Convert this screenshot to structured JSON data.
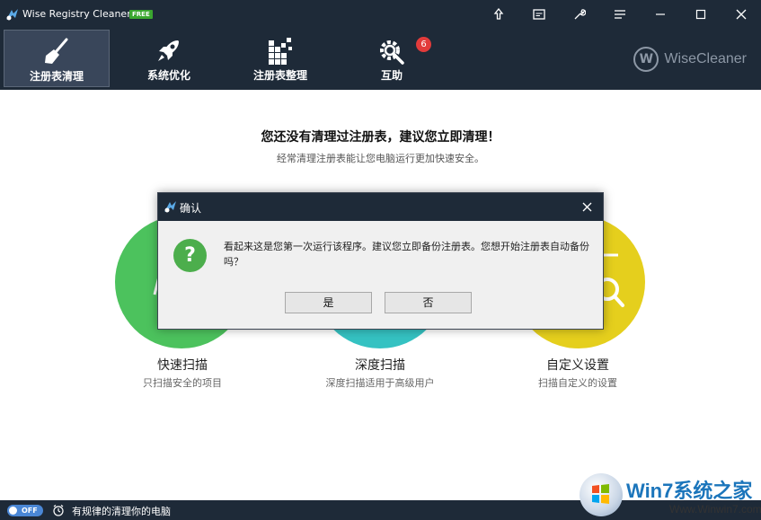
{
  "app": {
    "title": "Wise Registry Cleaner 9",
    "badge": "FREE"
  },
  "nav": {
    "items": [
      {
        "label": "注册表清理",
        "icon": "broom-icon"
      },
      {
        "label": "系统优化",
        "icon": "rocket-icon"
      },
      {
        "label": "注册表整理",
        "icon": "defrag-blocks-icon"
      },
      {
        "label": "互助",
        "icon": "gear-wrench-icon",
        "badge": "6"
      }
    ],
    "brand": "WiseCleaner",
    "brand_mark": "W"
  },
  "main": {
    "headline": "您还没有清理过注册表，建议您立即清理！",
    "subline": "经常清理注册表能让您电脑运行更加快速安全。",
    "options": [
      {
        "title": "快速扫描",
        "desc": "只扫描安全的项目",
        "color": "#4cc25d"
      },
      {
        "title": "深度扫描",
        "desc": "深度扫描适用于高级用户",
        "color": "#35c2c2"
      },
      {
        "title": "自定义设置",
        "desc": "扫描自定义的设置",
        "color": "#e5cf1d"
      }
    ]
  },
  "dialog": {
    "title": "确认",
    "message": "看起来这是您第一次运行该程序。建议您立即备份注册表。您想开始注册表自动备份吗？",
    "icon_glyph": "?",
    "yes_label": "是",
    "no_label": "否"
  },
  "statusbar": {
    "toggle_label": "OFF",
    "text": "有规律的清理你的电脑"
  },
  "watermark": {
    "title": "Win7系统之家",
    "url": "Www.Winwin7.com"
  },
  "colors": {
    "chrome": "#1e2a38",
    "accent_green": "#4cc25d",
    "accent_teal": "#35c2c2",
    "accent_yellow": "#e5cf1d",
    "badge_red": "#e23b3b"
  }
}
